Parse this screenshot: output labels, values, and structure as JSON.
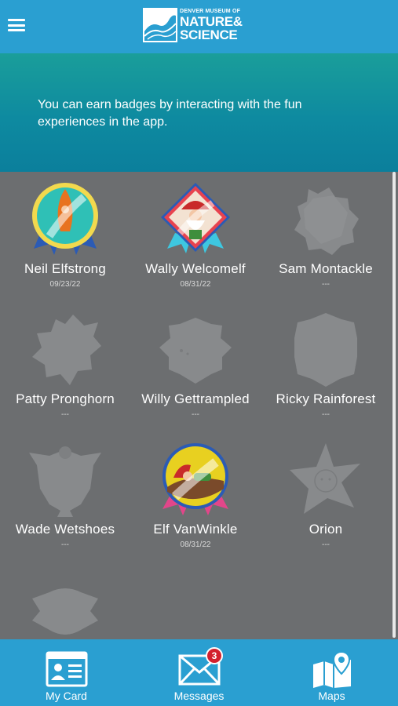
{
  "header": {
    "menu_icon": "hamburger-menu-icon",
    "logo": {
      "line1": "DENVER MUSEUM OF",
      "line2": "NATURE&",
      "line3": "SCIENCE"
    }
  },
  "banner": {
    "text": "You can earn badges by interacting with the fun experiences in the app."
  },
  "badges": [
    {
      "name": "Neil Elfstrong",
      "date": "09/23/22",
      "earned": true
    },
    {
      "name": "Wally Welcomelf",
      "date": "08/31/22",
      "earned": true
    },
    {
      "name": "Sam Montackle",
      "date": "---",
      "earned": false
    },
    {
      "name": "Patty Pronghorn",
      "date": "---",
      "earned": false
    },
    {
      "name": "Willy Gettrampled",
      "date": "---",
      "earned": false
    },
    {
      "name": "Ricky Rainforest",
      "date": "---",
      "earned": false
    },
    {
      "name": "Wade Wetshoes",
      "date": "---",
      "earned": false
    },
    {
      "name": "Elf VanWinkle",
      "date": "08/31/22",
      "earned": true
    },
    {
      "name": "Orion",
      "date": "---",
      "earned": false
    }
  ],
  "bottom_nav": {
    "items": [
      {
        "label": "My Card",
        "icon": "id-card-icon"
      },
      {
        "label": "Messages",
        "icon": "envelope-icon",
        "notification_count": "3"
      },
      {
        "label": "Maps",
        "icon": "map-pin-icon"
      }
    ]
  },
  "colors": {
    "header": "#2a9fd1",
    "banner": "#0e8aa0",
    "background": "#6c6e70",
    "notification": "#d3202e"
  }
}
